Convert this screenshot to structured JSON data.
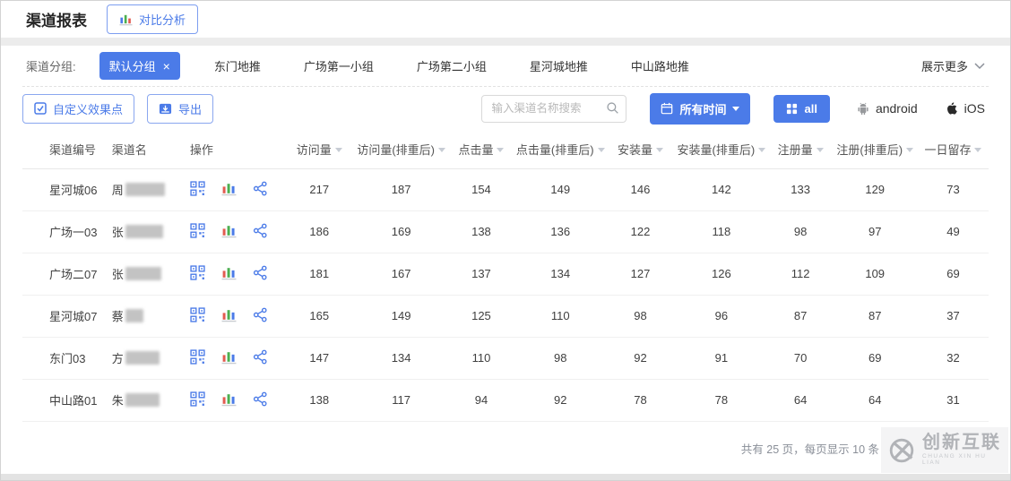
{
  "header": {
    "title": "渠道报表",
    "compare_button": "对比分析"
  },
  "filter": {
    "label": "渠道分组:",
    "selected_group": "默认分组",
    "remove_symbol": "×",
    "groups": [
      "东门地推",
      "广场第一小组",
      "广场第二小组",
      "星河城地推",
      "中山路地推"
    ],
    "show_more": "展示更多"
  },
  "toolbar": {
    "custom_points_button": "自定义效果点",
    "export_button": "导出",
    "search_placeholder": "输入渠道名称搜索",
    "time_filter_button": "所有时间",
    "platforms": {
      "all": "all",
      "android": "android",
      "ios": "iOS"
    },
    "icons": [
      "checkbox-icon",
      "export-icon",
      "search-icon",
      "calendar-icon",
      "grid-icon",
      "android-icon",
      "apple-icon"
    ]
  },
  "table": {
    "columns": [
      {
        "label": "渠道编号",
        "sortable": false
      },
      {
        "label": "渠道名",
        "sortable": false
      },
      {
        "label": "操作",
        "sortable": false
      },
      {
        "label": "访问量",
        "sortable": true
      },
      {
        "label": "访问量(排重后)",
        "sortable": true
      },
      {
        "label": "点击量",
        "sortable": true
      },
      {
        "label": "点击量(排重后)",
        "sortable": true
      },
      {
        "label": "安装量",
        "sortable": true
      },
      {
        "label": "安装量(排重后)",
        "sortable": true
      },
      {
        "label": "注册量",
        "sortable": true
      },
      {
        "label": "注册(排重后)",
        "sortable": true
      },
      {
        "label": "一日留存",
        "sortable": true
      }
    ],
    "action_icons": [
      "qrcode-icon",
      "bar-chart-icon",
      "share-icon"
    ],
    "rows": [
      {
        "id": "星河城06",
        "name": "周",
        "name_redacted": true,
        "mask_width": 44,
        "values": [
          217,
          187,
          154,
          149,
          146,
          142,
          133,
          129,
          73
        ]
      },
      {
        "id": "广场一03",
        "name": "张",
        "name_redacted": true,
        "mask_width": 42,
        "values": [
          186,
          169,
          138,
          136,
          122,
          118,
          98,
          97,
          49
        ]
      },
      {
        "id": "广场二07",
        "name": "张",
        "name_redacted": true,
        "mask_width": 40,
        "values": [
          181,
          167,
          137,
          134,
          127,
          126,
          112,
          109,
          69
        ]
      },
      {
        "id": "星河城07",
        "name": "蔡",
        "name_redacted": true,
        "mask_width": 20,
        "values": [
          165,
          149,
          125,
          110,
          98,
          96,
          87,
          87,
          37
        ]
      },
      {
        "id": "东门03",
        "name": "方",
        "name_redacted": true,
        "mask_width": 38,
        "values": [
          147,
          134,
          110,
          98,
          92,
          91,
          70,
          69,
          32
        ]
      },
      {
        "id": "中山路01",
        "name": "朱",
        "name_redacted": true,
        "mask_width": 38,
        "values": [
          138,
          117,
          94,
          92,
          78,
          78,
          64,
          64,
          31
        ]
      }
    ]
  },
  "footer": {
    "pagination": "共有 25 页，每页显示 10 条"
  },
  "watermark": {
    "name": "创新互联",
    "subtitle": "CHUANG XIN HU LIAN"
  },
  "colors": {
    "accent": "#4b7be8",
    "chart_red": "#e25b50",
    "chart_green": "#4caf50",
    "chart_blue": "#4b7be8",
    "gray_icon": "#97999c"
  }
}
